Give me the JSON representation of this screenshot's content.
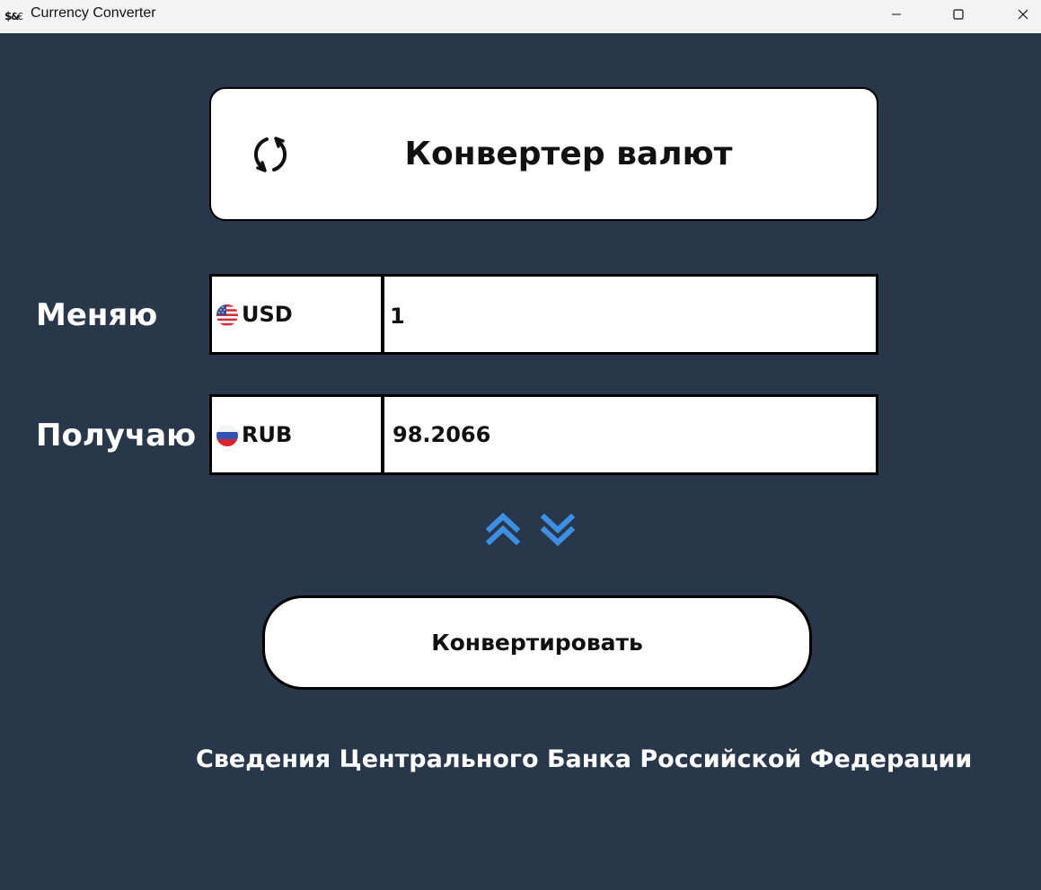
{
  "window": {
    "title": "Currency Converter",
    "icon": "app-icon",
    "controls": [
      "minimize-icon",
      "maximize-icon",
      "close-icon"
    ]
  },
  "header": {
    "icon": "refresh-icon",
    "title": "Конвертер валют"
  },
  "give": {
    "label": "Меняю",
    "currency": "USD",
    "flag": "us-flag-icon",
    "amount": "1"
  },
  "get": {
    "label": "Получаю",
    "currency": "RUB",
    "flag": "ru-flag-icon",
    "amount": "98.2066"
  },
  "swap": {
    "up_icon": "double-chevron-up-icon",
    "down_icon": "double-chevron-down-icon"
  },
  "actions": {
    "convert_label": "Конвертировать"
  },
  "footer": {
    "source": "Сведения Центрального Банка Российской Федерации"
  },
  "colors": {
    "background": "#29374a",
    "titlebar": "#f3f3f3",
    "card": "#ffffff",
    "border": "#000000",
    "accent_arrows": "#3d8fe3"
  }
}
